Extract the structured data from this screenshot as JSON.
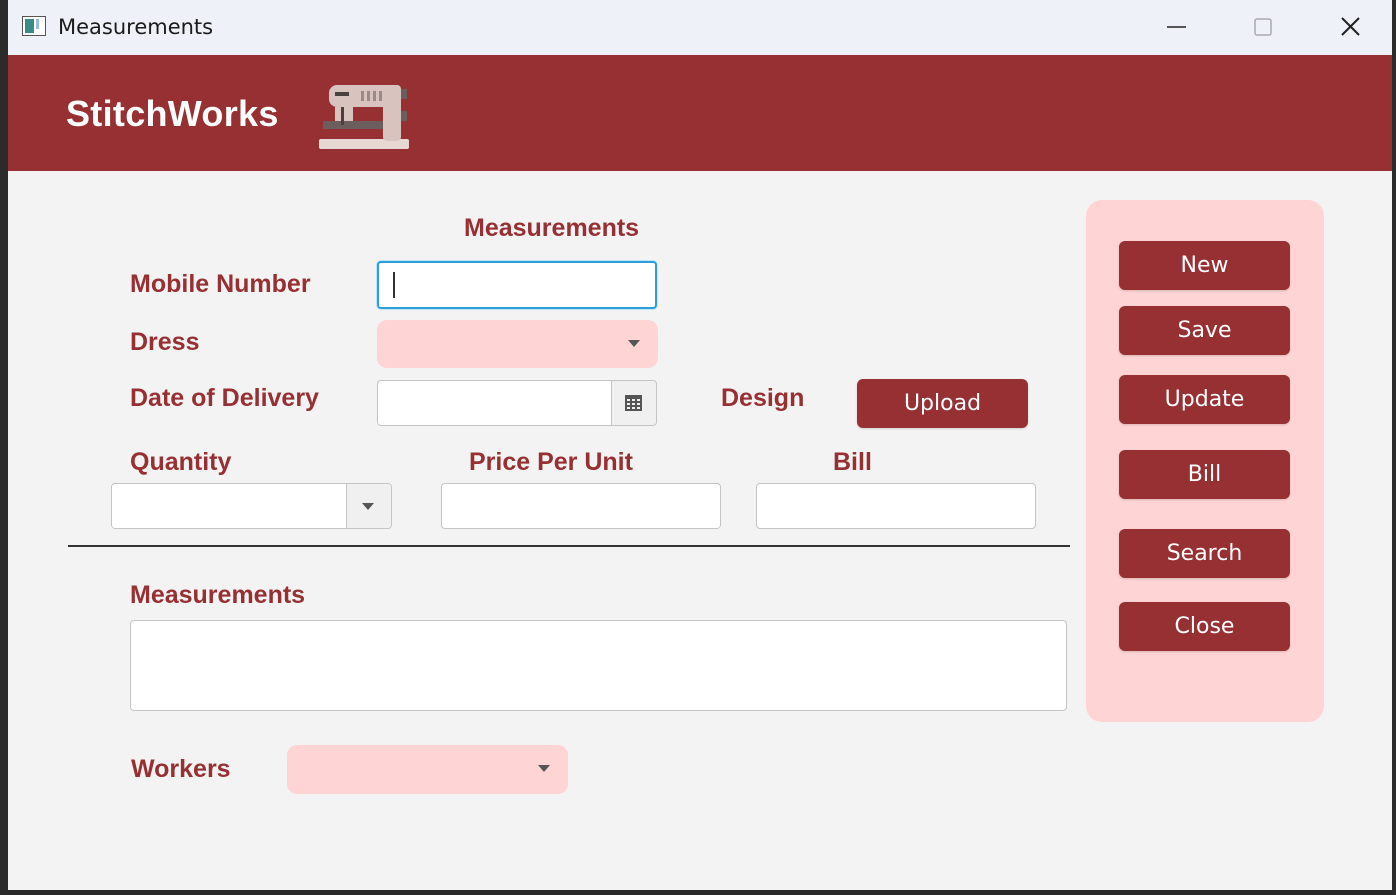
{
  "window": {
    "title": "Measurements"
  },
  "header": {
    "brand": "StitchWorks",
    "icon": "sewing-machine-icon",
    "color": "#973033"
  },
  "form": {
    "section_title": "Measurements",
    "mobile_label": "Mobile Number",
    "mobile_value": "",
    "dress_label": "Dress",
    "dress_value": "",
    "delivery_label": "Date of Delivery",
    "delivery_value": "",
    "design_label": "Design",
    "upload_label": "Upload",
    "quantity_label": "Quantity",
    "quantity_value": "",
    "price_label": "Price Per Unit",
    "price_value": "",
    "bill_label": "Bill",
    "bill_value": "",
    "measurements_label": "Measurements",
    "measurements_value": "",
    "workers_label": "Workers",
    "workers_value": ""
  },
  "actions": {
    "new": "New",
    "save": "Save",
    "update": "Update",
    "bill": "Bill",
    "search": "Search",
    "close": "Close"
  },
  "colors": {
    "accent": "#973033",
    "panel": "#ffd4d4",
    "focus": "#2c9fd9"
  }
}
